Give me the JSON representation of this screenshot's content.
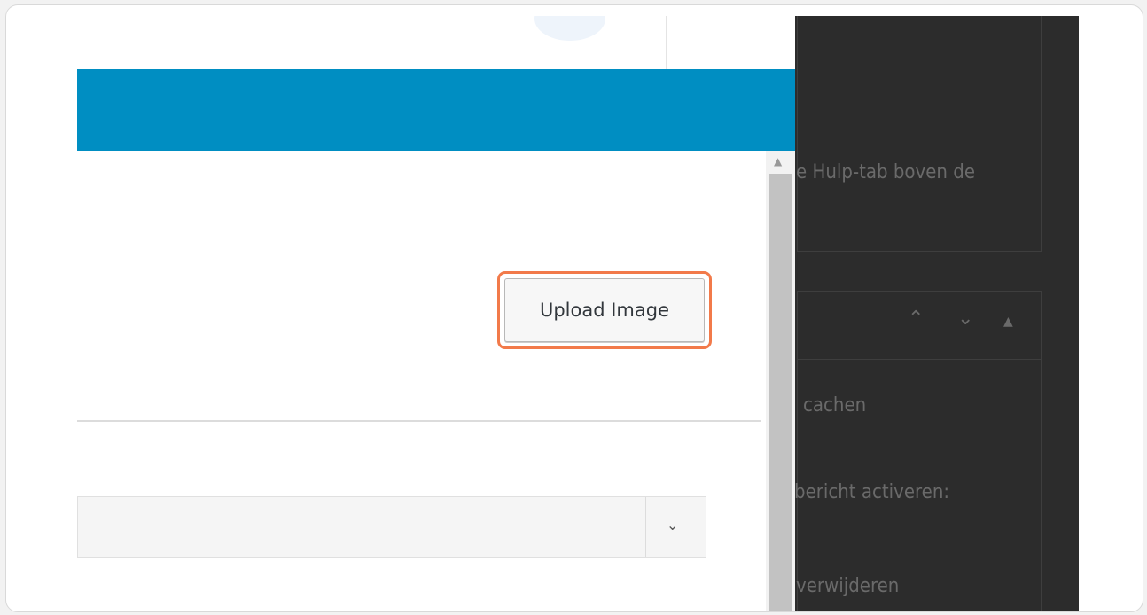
{
  "modal": {
    "upload_button_label": "Upload Image",
    "select_arrow": "⌄"
  },
  "right_panel": {
    "text_line1": "e Hulp-tab boven de",
    "text_cache": "cachen",
    "text_notice": "bericht activeren:",
    "text_remove": "verwijderen",
    "controls": {
      "up": "⌃",
      "down": "⌄",
      "toggle": "▲"
    }
  },
  "scrollbar": {
    "up_arrow": "▲"
  },
  "colors": {
    "header_blue": "#008ec2",
    "highlight_orange": "#f27a4a",
    "overlay_dark": "#2c2c2c"
  },
  "icons": [
    "chevron-down-icon",
    "scroll-up-arrow-icon",
    "chevron-up-icon",
    "triangle-up-icon"
  ]
}
